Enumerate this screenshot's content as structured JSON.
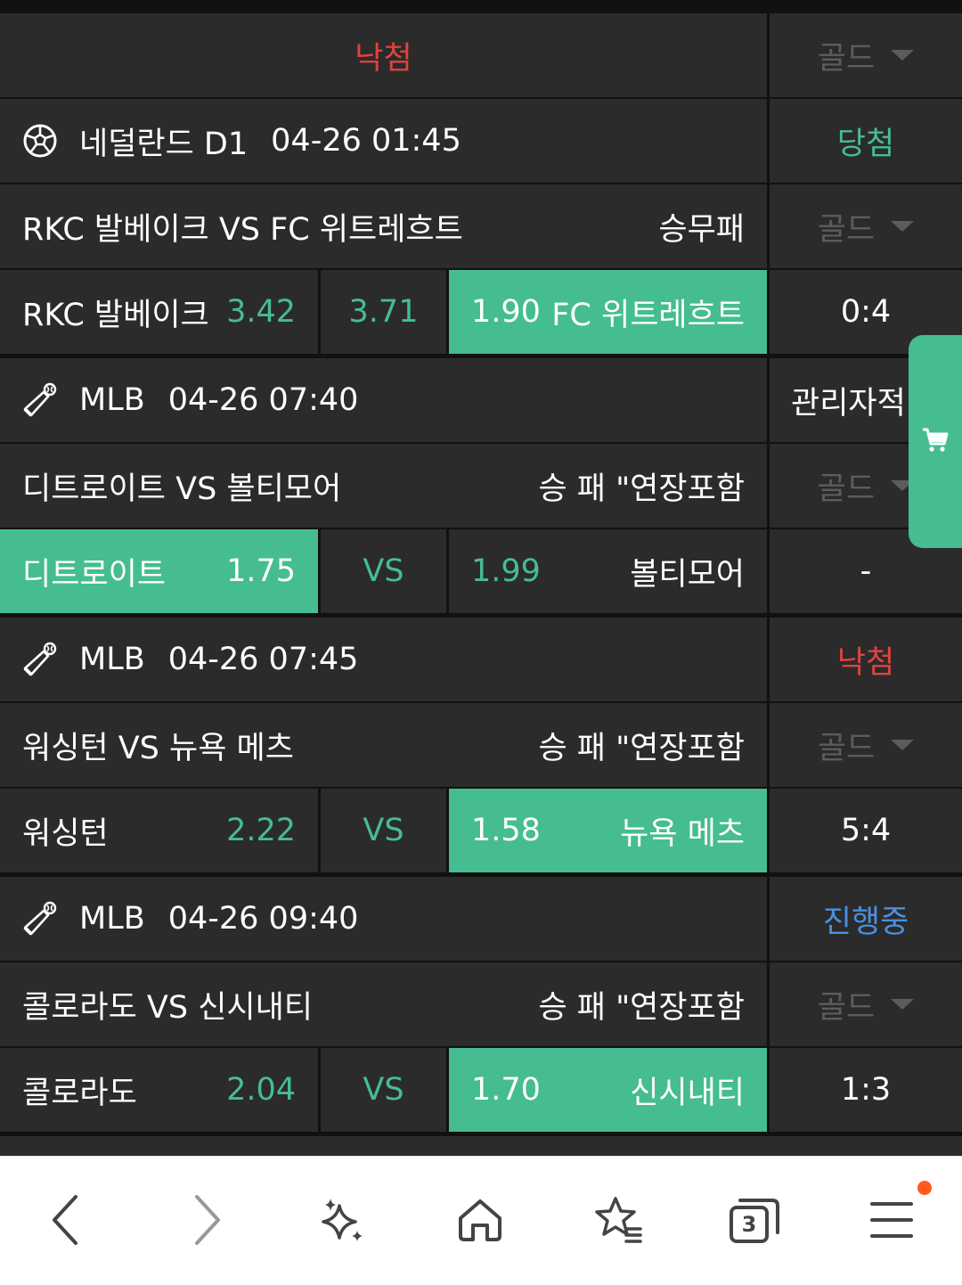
{
  "rows": {
    "r0": {
      "status": "낙첨",
      "gold": "골드"
    },
    "g1": {
      "league": "네덜란드 D1",
      "time": "04-26 01:45",
      "status": "당첨",
      "matchup": "RKC 발베이크 VS FC 위트레흐트",
      "market": "승무패",
      "gold": "골드",
      "home": {
        "name": "RKC 발베이크",
        "odds": "3.42"
      },
      "draw": "3.71",
      "away": {
        "odds": "1.90",
        "name": "FC 위트레흐트"
      },
      "score": "0:4"
    },
    "g2": {
      "league": "MLB",
      "time": "04-26 07:40",
      "status": "관리자적",
      "matchup": "디트로이트 VS 볼티모어",
      "market": "승 패 \"연장포함",
      "gold": "골드",
      "home": {
        "name": "디트로이트",
        "odds": "1.75"
      },
      "draw": "VS",
      "away": {
        "odds": "1.99",
        "name": "볼티모어"
      },
      "score": "-"
    },
    "g3": {
      "league": "MLB",
      "time": "04-26 07:45",
      "status": "낙첨",
      "matchup": "워싱턴 VS 뉴욕 메츠",
      "market": "승 패 \"연장포함",
      "gold": "골드",
      "home": {
        "name": "워싱턴",
        "odds": "2.22"
      },
      "draw": "VS",
      "away": {
        "odds": "1.58",
        "name": "뉴욕 메츠"
      },
      "score": "5:4"
    },
    "g4": {
      "league": "MLB",
      "time": "04-26 09:40",
      "status": "진행중",
      "matchup": "콜로라도 VS 신시내티",
      "market": "승 패 \"연장포함",
      "gold": "골드",
      "home": {
        "name": "콜로라도",
        "odds": "2.04"
      },
      "draw": "VS",
      "away": {
        "odds": "1.70",
        "name": "신시내티"
      },
      "score": "1:3"
    }
  },
  "cart": {
    "icon": "cart-icon"
  },
  "nav": {
    "tabs_count": "3",
    "icons": [
      "back-icon",
      "forward-icon",
      "sparkle-icon",
      "home-icon",
      "bookmarks-icon",
      "tabs-icon",
      "menu-icon"
    ]
  },
  "colors": {
    "accent": "#45bd90",
    "lose": "#e0423c",
    "progress": "#4a90e2",
    "cell": "#2b2b2b",
    "muted": "#5c5c5c"
  }
}
